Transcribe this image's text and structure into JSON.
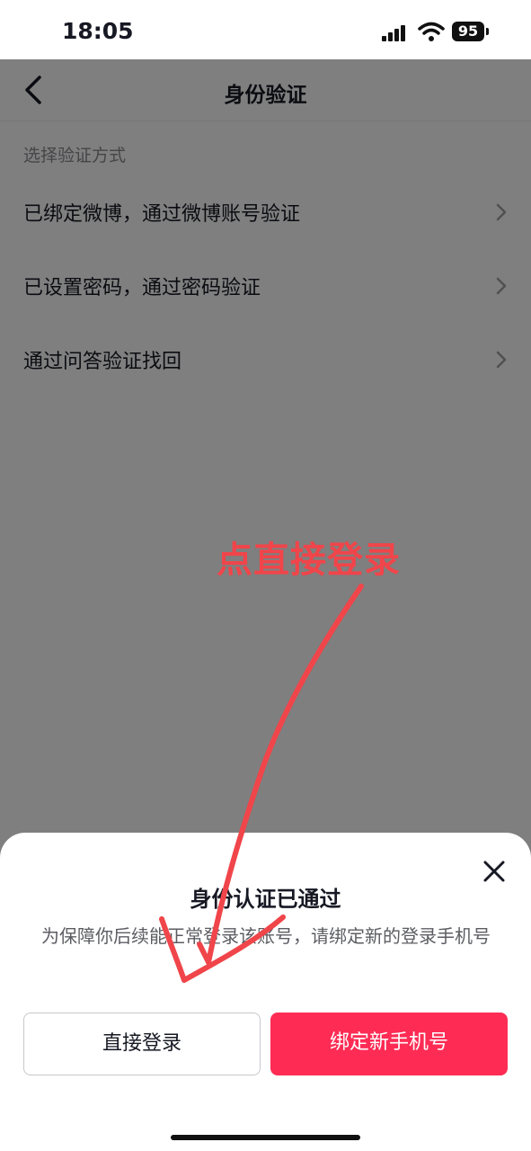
{
  "status_bar": {
    "time": "18:05",
    "battery": "95"
  },
  "nav": {
    "title": "身份验证"
  },
  "section_label": "选择验证方式",
  "options": [
    {
      "label": "已绑定微博，通过微博账号验证"
    },
    {
      "label": "已设置密码，通过密码验证"
    },
    {
      "label": "通过问答验证找回"
    }
  ],
  "sheet": {
    "title": "身份认证已通过",
    "description": "为保障你后续能正常登录该账号，请绑定新的登录手机号",
    "login_button": "直接登录",
    "bind_button": "绑定新手机号"
  },
  "annotation": {
    "text": "点直接登录"
  },
  "colors": {
    "accent": "#fe2c55",
    "annotation": "#f0454a"
  }
}
